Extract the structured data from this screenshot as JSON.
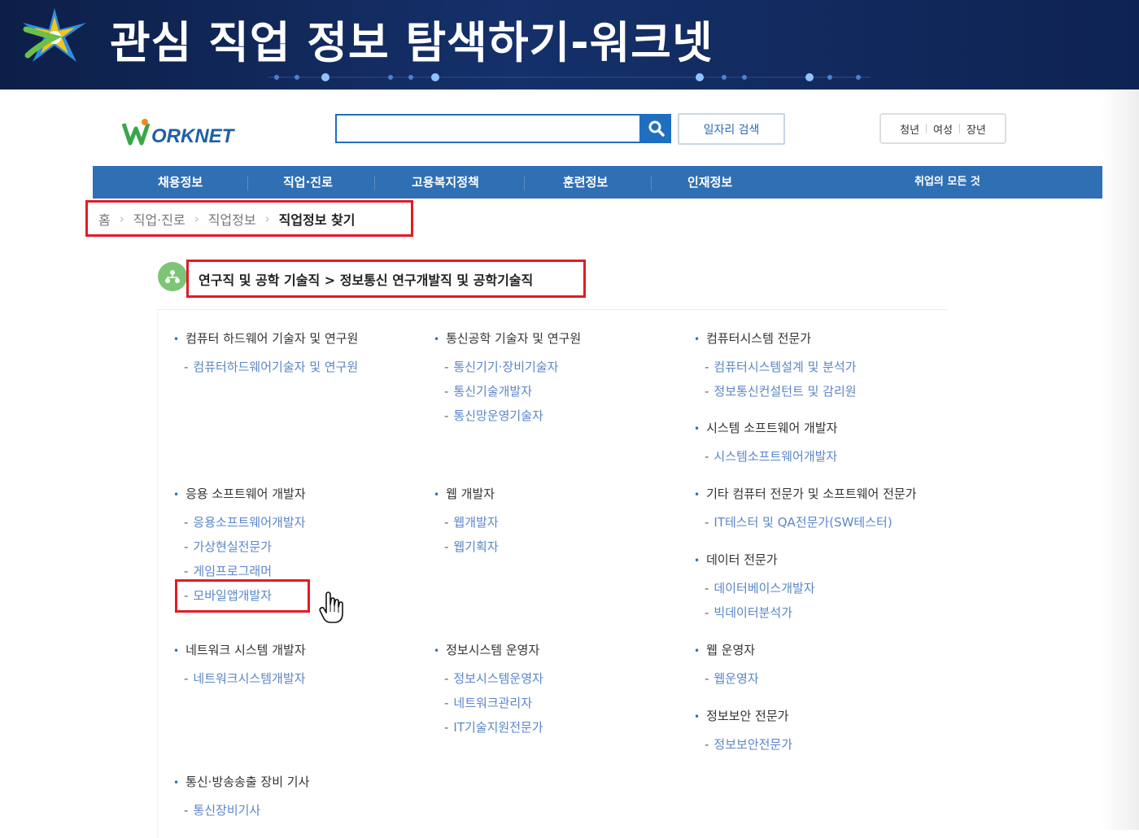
{
  "banner": {
    "title": "관심 직업 정보 탐색하기-워크넷"
  },
  "header": {
    "logo_text": "WORKNET",
    "search_placeholder": "",
    "job_search_label": "일자리 검색",
    "target_links": [
      "청년",
      "여성",
      "장년"
    ]
  },
  "gnb": {
    "items": [
      "채용정보",
      "직업·진로",
      "고용복지정책",
      "훈련정보",
      "인재정보"
    ],
    "all_label": "취업의 모든 것"
  },
  "breadcrumb": {
    "items": [
      "홈",
      "직업·진로",
      "직업정보"
    ],
    "current": "직업정보 찾기"
  },
  "category": {
    "title": "연구직 및 공학 기술직 > 정보통신 연구개발직 및 공학기술직"
  },
  "groups": [
    {
      "title": "컴퓨터 하드웨어 기술자 및 연구원",
      "items": [
        "컴퓨터하드웨어기술자 및 연구원"
      ]
    },
    {
      "title": "통신공학 기술자 및 연구원",
      "items": [
        "통신기기·장비기술자",
        "통신기술개발자",
        "통신망운영기술자"
      ]
    },
    {
      "title": "컴퓨터시스템 전문가",
      "items": [
        "컴퓨터시스템설계 및 분석가",
        "정보통신컨설턴트 및 감리원"
      ]
    },
    {
      "title": "시스템 소프트웨어 개발자",
      "items": [
        "시스템소프트웨어개발자"
      ]
    },
    {
      "title": "응용 소프트웨어 개발자",
      "items": [
        "응용소프트웨어개발자",
        "가상현실전문가",
        "게임프로그래머",
        "모바일앱개발자"
      ]
    },
    {
      "title": "웹 개발자",
      "items": [
        "웹개발자",
        "웹기획자"
      ]
    },
    {
      "title": "기타 컴퓨터 전문가 및 소프트웨어 전문가",
      "items": [
        "IT테스터 및 QA전문가(SW테스터)"
      ]
    },
    {
      "title": "데이터 전문가",
      "items": [
        "데이터베이스개발자",
        "빅데이터분석가"
      ]
    },
    {
      "title": "네트워크 시스템 개발자",
      "items": [
        "네트워크시스템개발자"
      ]
    },
    {
      "title": "정보시스템 운영자",
      "items": [
        "정보시스템운영자",
        "네트워크관리자",
        "IT기술지원전문가"
      ]
    },
    {
      "title": "웹 운영자",
      "items": [
        "웹운영자"
      ]
    },
    {
      "title": "정보보안 전문가",
      "items": [
        "정보보안전문가"
      ]
    },
    {
      "title": "통신·방송송출 장비 기사",
      "items": [
        "통신장비기사"
      ]
    }
  ],
  "colors": {
    "accent": "#2f6fb4",
    "highlight": "#e31b23",
    "link": "#5a86c8"
  }
}
